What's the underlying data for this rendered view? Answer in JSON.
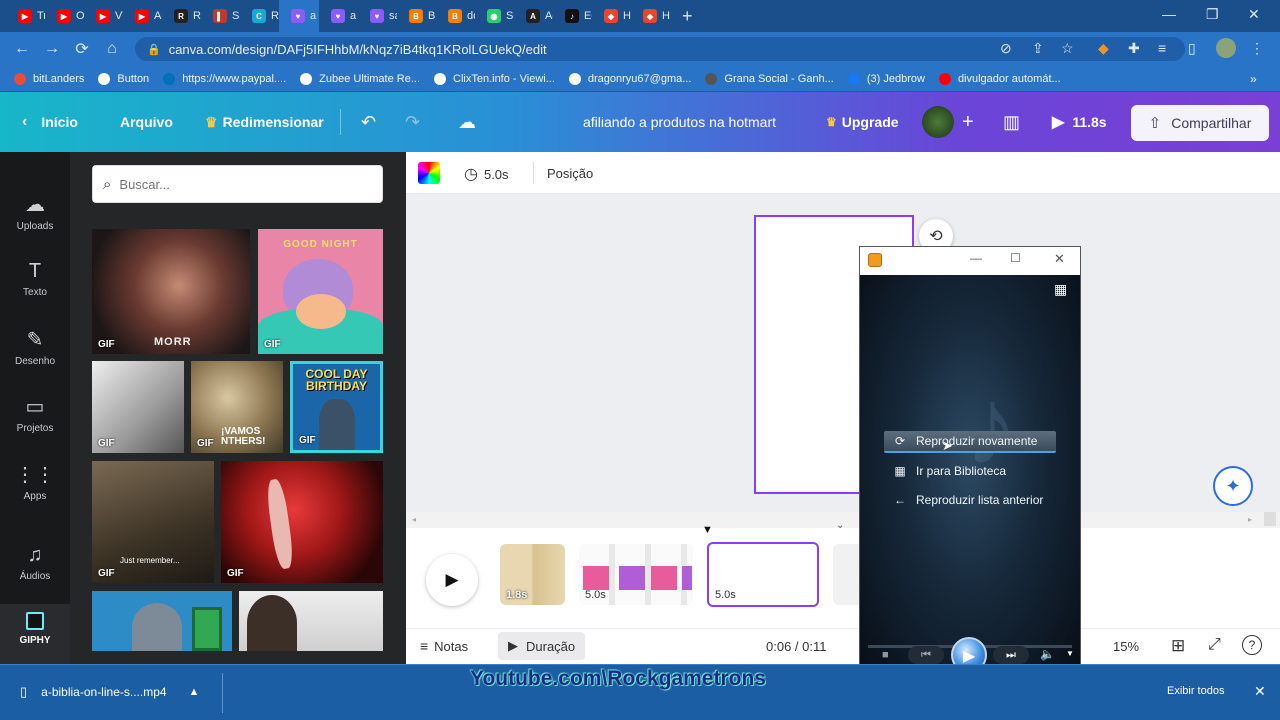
{
  "browser": {
    "tabs": [
      {
        "label": "Tran",
        "color": "#ff0000",
        "glyph": "▶"
      },
      {
        "label": "O C",
        "color": "#ff0000",
        "glyph": "▶"
      },
      {
        "label": "VTV",
        "color": "#ff0000",
        "glyph": "▶"
      },
      {
        "label": "As R",
        "color": "#ff0000",
        "glyph": "▶"
      },
      {
        "label": "Rapi",
        "color": "#222222",
        "glyph": "R"
      },
      {
        "label": "Salm",
        "color": "#c0392b",
        "glyph": "▌"
      },
      {
        "label": "Reco",
        "color": "#19a7d6",
        "glyph": "C"
      },
      {
        "label": "a",
        "color": "#8b5cf6",
        "glyph": "♥",
        "active": true
      },
      {
        "label": "a bí",
        "color": "#8b5cf6",
        "glyph": "♥"
      },
      {
        "label": "salm",
        "color": "#8b5cf6",
        "glyph": "♥"
      },
      {
        "label": "Blog",
        "color": "#f57d00",
        "glyph": "B"
      },
      {
        "label": "dow",
        "color": "#f57d00",
        "glyph": "B"
      },
      {
        "label": "Scas",
        "color": "#2ecc71",
        "glyph": "◉"
      },
      {
        "label": "Ado",
        "color": "#222222",
        "glyph": "A"
      },
      {
        "label": "Edva",
        "color": "#111111",
        "glyph": "♪"
      },
      {
        "label": "Hot",
        "color": "#e8462c",
        "glyph": "◆"
      },
      {
        "label": "Hot",
        "color": "#e8462c",
        "glyph": "◆"
      }
    ],
    "url": "canva.com/design/DAFj5IFHhbM/kNqz7iB4tkq1KRolLGUekQ/edit",
    "bookmarks": [
      {
        "label": "bitLanders",
        "color": "#e74c3c"
      },
      {
        "label": "Button",
        "color": "#ffffff"
      },
      {
        "label": "https://www.paypal....",
        "color": "#0070ba"
      },
      {
        "label": "Zubee Ultimate Re...",
        "color": "#ffffff"
      },
      {
        "label": "ClixTen.info - Viewi...",
        "color": "#ffffff"
      },
      {
        "label": "dragonryu67@gma...",
        "color": "#ffffff"
      },
      {
        "label": "Grana Social - Ganh...",
        "color": "#555555"
      },
      {
        "label": "(3) Jedbrow",
        "color": "#1877f2"
      },
      {
        "label": "divulgador automát...",
        "color": "#ff0000"
      }
    ]
  },
  "canva": {
    "nav": {
      "home": "Início",
      "file": "Arquivo",
      "resize": "Redimensionar"
    },
    "doc_title": "afiliando a produtos na hotmart",
    "upgrade": "Upgrade",
    "play_duration": "11.8s",
    "share": "Compartilhar",
    "rail": [
      {
        "label": "Uploads",
        "icon": "☁"
      },
      {
        "label": "Texto",
        "icon": "T"
      },
      {
        "label": "Desenho",
        "icon": "✎"
      },
      {
        "label": "Projetos",
        "icon": "▭"
      },
      {
        "label": "Apps",
        "icon": "⋮⋮"
      },
      {
        "label": "Áudios",
        "icon": "♫"
      },
      {
        "label": "GIPHY",
        "icon": "▣"
      }
    ],
    "search_placeholder": "Buscar...",
    "gif_label": "GIF",
    "gif_texts": [
      "MORR",
      "GOOD NIGHT",
      "COOL DAY BIRTHDAY",
      "¡VAMOS NTHERS!",
      "Just remember..."
    ],
    "toolbar": {
      "duration": "5.0s",
      "position": "Posição"
    },
    "timeline": {
      "clips": [
        "1.8s",
        "5.0s",
        "5.0s"
      ]
    },
    "bottom": {
      "notes": "Notas",
      "duration": "Duração",
      "time": "0:06 / 0:11",
      "zoom": "15%",
      "help": "?"
    }
  },
  "player": {
    "menu": [
      {
        "label": "Reproduzir novamente",
        "icon": "⟳"
      },
      {
        "label": "Ir para Biblioteca",
        "icon": "▦"
      },
      {
        "label": "Reproduzir lista anterior",
        "icon": "←"
      }
    ]
  },
  "download": {
    "file": "a-biblia-on-line-s....mp4",
    "show_all": "Exibir todos"
  },
  "watermark": "Youtube.com\\Rockgametrons"
}
